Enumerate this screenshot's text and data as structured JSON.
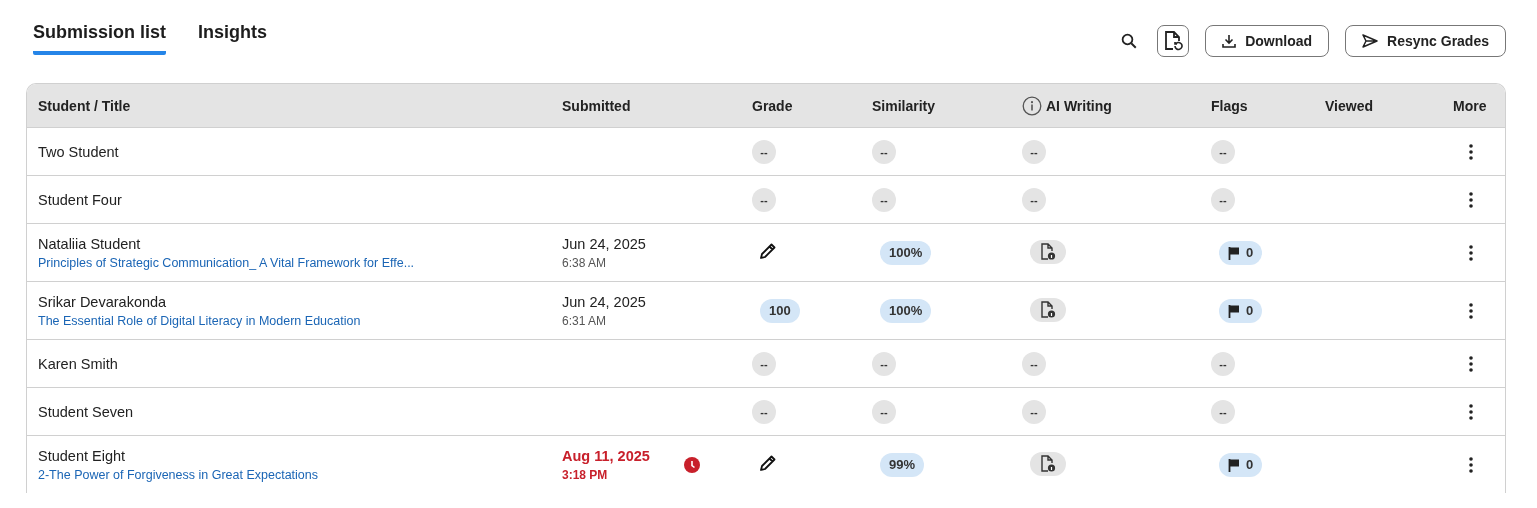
{
  "tabs": [
    {
      "label": "Submission list",
      "selected": true
    },
    {
      "label": "Insights",
      "selected": false
    }
  ],
  "toolbar": {
    "download": "Download",
    "resync": "Resync Grades"
  },
  "table": {
    "columns": [
      "Student / Title",
      "Submitted",
      "Grade",
      "Similarity",
      "AI Writing",
      "Flags",
      "Viewed",
      "More"
    ],
    "rows": [
      {
        "student": "Two Student",
        "grade": {
          "kind": "empty",
          "text": "--"
        },
        "similarity": {
          "kind": "empty",
          "text": "--"
        },
        "ai": {
          "kind": "empty",
          "text": "--"
        },
        "flags": {
          "kind": "empty",
          "text": "--"
        }
      },
      {
        "student": "Student Four",
        "grade": {
          "kind": "empty",
          "text": "--"
        },
        "similarity": {
          "kind": "empty",
          "text": "--"
        },
        "ai": {
          "kind": "empty",
          "text": "--"
        },
        "flags": {
          "kind": "empty",
          "text": "--"
        }
      },
      {
        "student": "Nataliia Student",
        "title": "Principles of Strategic Communication_ A Vital Framework for Effe...",
        "submitted": {
          "date": "Jun 24, 2025",
          "time": "6:38 AM",
          "late": false
        },
        "grade": {
          "kind": "edit"
        },
        "similarity": {
          "kind": "value",
          "text": "100%"
        },
        "ai": {
          "kind": "report"
        },
        "flags": {
          "kind": "flag",
          "text": "0"
        }
      },
      {
        "student": "Srikar Devarakonda",
        "title": "The Essential Role of Digital Literacy in Modern Education",
        "submitted": {
          "date": "Jun 24, 2025",
          "time": "6:31 AM",
          "late": false
        },
        "grade": {
          "kind": "value",
          "text": "100"
        },
        "similarity": {
          "kind": "value",
          "text": "100%"
        },
        "ai": {
          "kind": "report"
        },
        "flags": {
          "kind": "flag",
          "text": "0"
        }
      },
      {
        "student": "Karen Smith",
        "grade": {
          "kind": "empty",
          "text": "--"
        },
        "similarity": {
          "kind": "empty",
          "text": "--"
        },
        "ai": {
          "kind": "empty",
          "text": "--"
        },
        "flags": {
          "kind": "empty",
          "text": "--"
        }
      },
      {
        "student": "Student Seven",
        "grade": {
          "kind": "empty",
          "text": "--"
        },
        "similarity": {
          "kind": "empty",
          "text": "--"
        },
        "ai": {
          "kind": "empty",
          "text": "--"
        },
        "flags": {
          "kind": "empty",
          "text": "--"
        }
      },
      {
        "student": "Student Eight",
        "title": "2-The Power of Forgiveness in Great Expectations",
        "submitted": {
          "date": "Aug 11, 2025",
          "time": "3:18 PM",
          "late": true
        },
        "grade": {
          "kind": "edit"
        },
        "similarity": {
          "kind": "value",
          "text": "99%"
        },
        "ai": {
          "kind": "report"
        },
        "flags": {
          "kind": "flag",
          "text": "0"
        }
      }
    ]
  }
}
